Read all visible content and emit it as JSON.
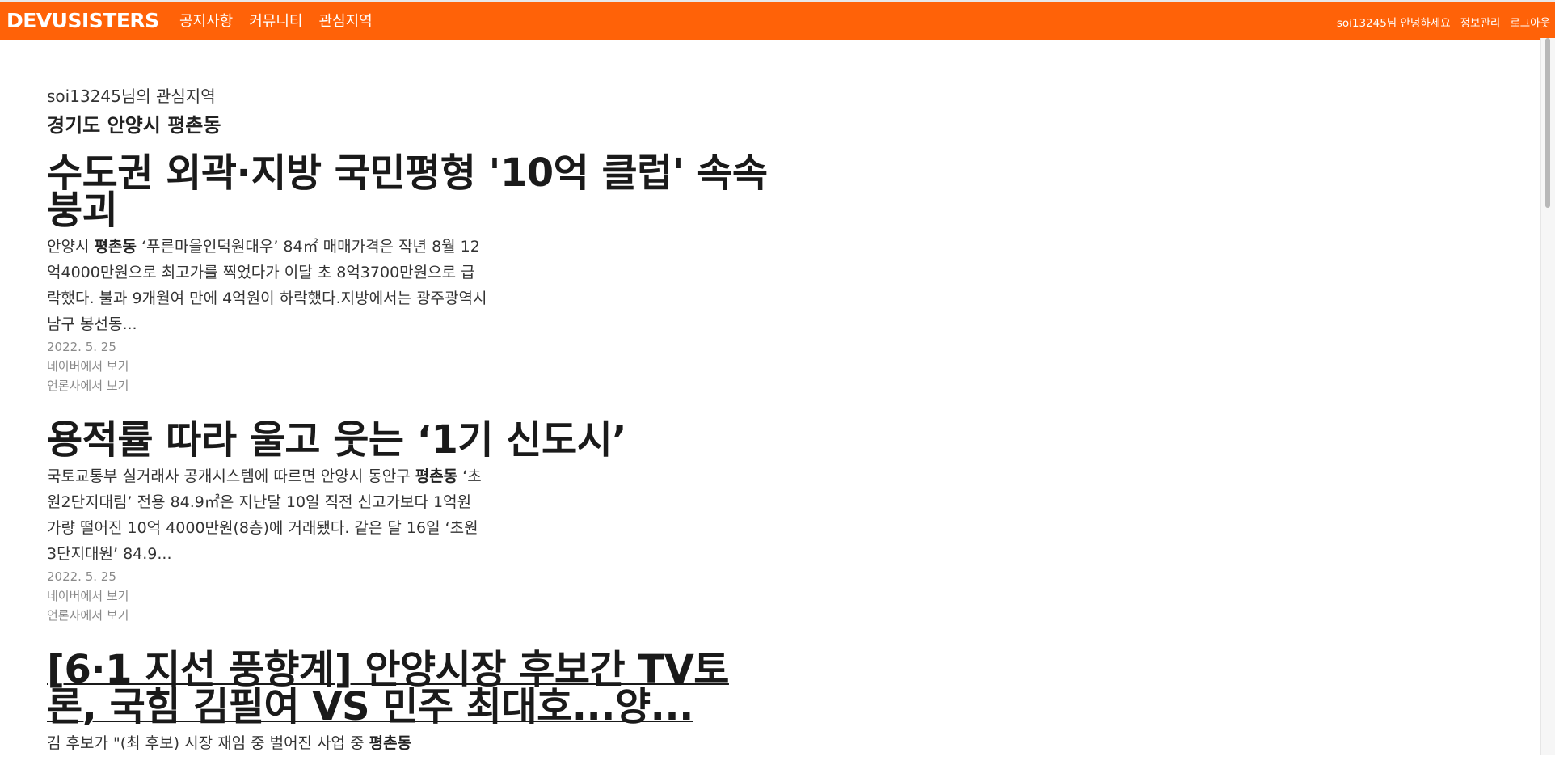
{
  "header": {
    "logo": "DEVUSISTERS",
    "menu": [
      "공지사항",
      "커뮤니티",
      "관심지역"
    ],
    "greeting": "soi13245님 안녕하세요",
    "account": "정보관리",
    "logout": "로그아웃"
  },
  "main": {
    "caption": "soi13245님의 관심지역",
    "region": "경기도 안양시 평촌동"
  },
  "articles": [
    {
      "title": "수도권 외곽·지방 국민평형 '10억 클럽' 속속 붕괴",
      "desc_pre": "안양시 ",
      "desc_bold": "평촌동",
      "desc_post": " ‘푸른마을인덕원대우’ 84㎡ 매매가격은 작년 8월 12억4000만원으로 최고가를 찍었다가 이달 초 8억3700만원으로 급락했다. 불과 9개월여 만에 4억원이 하락했다.지방에서는 광주광역시 남구 봉선동...",
      "date": "2022. 5. 25",
      "naver": "네이버에서 보기",
      "press": "언론사에서 보기"
    },
    {
      "title": "용적률 따라 울고 웃는 ‘1기 신도시’",
      "desc_pre": "국토교통부 실거래사 공개시스템에 따르면 안양시 동안구 ",
      "desc_bold": "평촌동",
      "desc_post": " ‘초원2단지대림’ 전용 84.9㎡은 지난달 10일 직전 신고가보다 1억원 가량 떨어진 10억 4000만원(8층)에 거래됐다. 같은 달 16일 ‘초원3단지대원’ 84.9...",
      "date": "2022. 5. 25",
      "naver": "네이버에서 보기",
      "press": "언론사에서 보기"
    },
    {
      "title": "[6·1 지선 풍향계] 안양시장 후보간 TV토론, 국힘 김필여 VS 민주 최대호...양...",
      "desc_pre": "김 후보가 \"(최 후보) 시장 재임 중 벌어진 사업 중 ",
      "desc_bold": "평촌동",
      "desc_post": "",
      "date": "",
      "naver": "",
      "press": ""
    }
  ]
}
